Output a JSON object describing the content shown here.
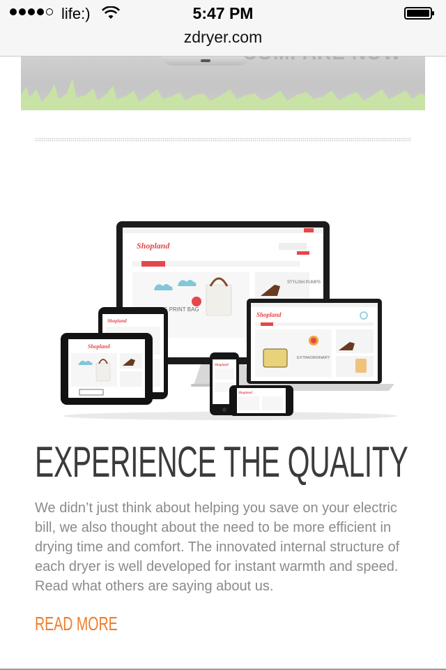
{
  "status_bar": {
    "carrier": "life:)",
    "time": "5:47 PM",
    "url": "zdryer.com",
    "signal_bars_filled": 4,
    "signal_bars_total": 5
  },
  "banner": {
    "cta_text": "COMPARE NOW"
  },
  "section": {
    "headline": "EXPERIENCE THE QUALITY",
    "body": "We didn’t just think about helping you save on your electric bill, we also thought about the need to be more efficient in drying time and comfort. The innovated internal structure of each dryer is well developed for instant warmth and speed. Read what others are saying about us.",
    "read_more": "READ MORE"
  },
  "illustration": {
    "brand": "Shopland",
    "promo_1": "AMAZING PRINT BAG",
    "promo_2": "STYLISH PUMPS",
    "promo_3": "EXTRAORDINARY"
  },
  "colors": {
    "headline": "#3b3b3b",
    "body_text": "#8a8a8a",
    "link_orange": "#ee7d2b",
    "grass_green": "#c9e2a6",
    "brand_red": "#e4474b"
  }
}
